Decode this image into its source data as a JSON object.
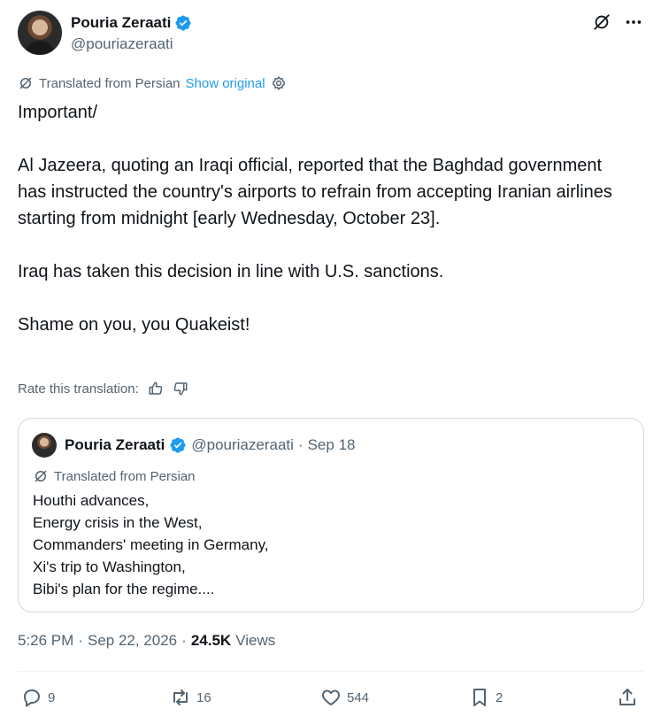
{
  "author": {
    "display_name": "Pouria Zeraati",
    "handle": "@pouriazeraati"
  },
  "translation_bar": {
    "label": "Translated from Persian",
    "show_original": "Show original"
  },
  "tweet": {
    "line_1": "Important/",
    "para_1": "Al Jazeera, quoting an Iraqi official, reported that the Baghdad government has instructed the country's airports to refrain from accepting Iranian airlines starting from midnight [early Wednesday, October 23].",
    "para_2": "Iraq has taken this decision in line with U.S. sanctions.",
    "para_3": "Shame on you, you Quakeist!"
  },
  "rate": {
    "label": "Rate this translation:"
  },
  "quote": {
    "display_name": "Pouria Zeraati",
    "handle": "@pouriazeraati",
    "separator": "·",
    "date": "Sep 18",
    "translated_label": "Translated from Persian",
    "lines": [
      "Houthi advances,",
      "Energy crisis in the West,",
      "Commanders' meeting in Germany,",
      "Xi's trip to Washington,",
      "Bibi's plan for the regime...."
    ]
  },
  "meta": {
    "time": "5:26 PM",
    "sep1": "·",
    "date": "Sep 22, 2026",
    "sep2": "·",
    "views_count": "24.5K",
    "views_label": "Views"
  },
  "actions": {
    "replies": "9",
    "reposts": "16",
    "likes": "544",
    "bookmarks": "2"
  },
  "colors": {
    "accent": "#1d9bf0",
    "text": "#0f1419",
    "secondary": "#536471",
    "border": "#cfd9de"
  }
}
